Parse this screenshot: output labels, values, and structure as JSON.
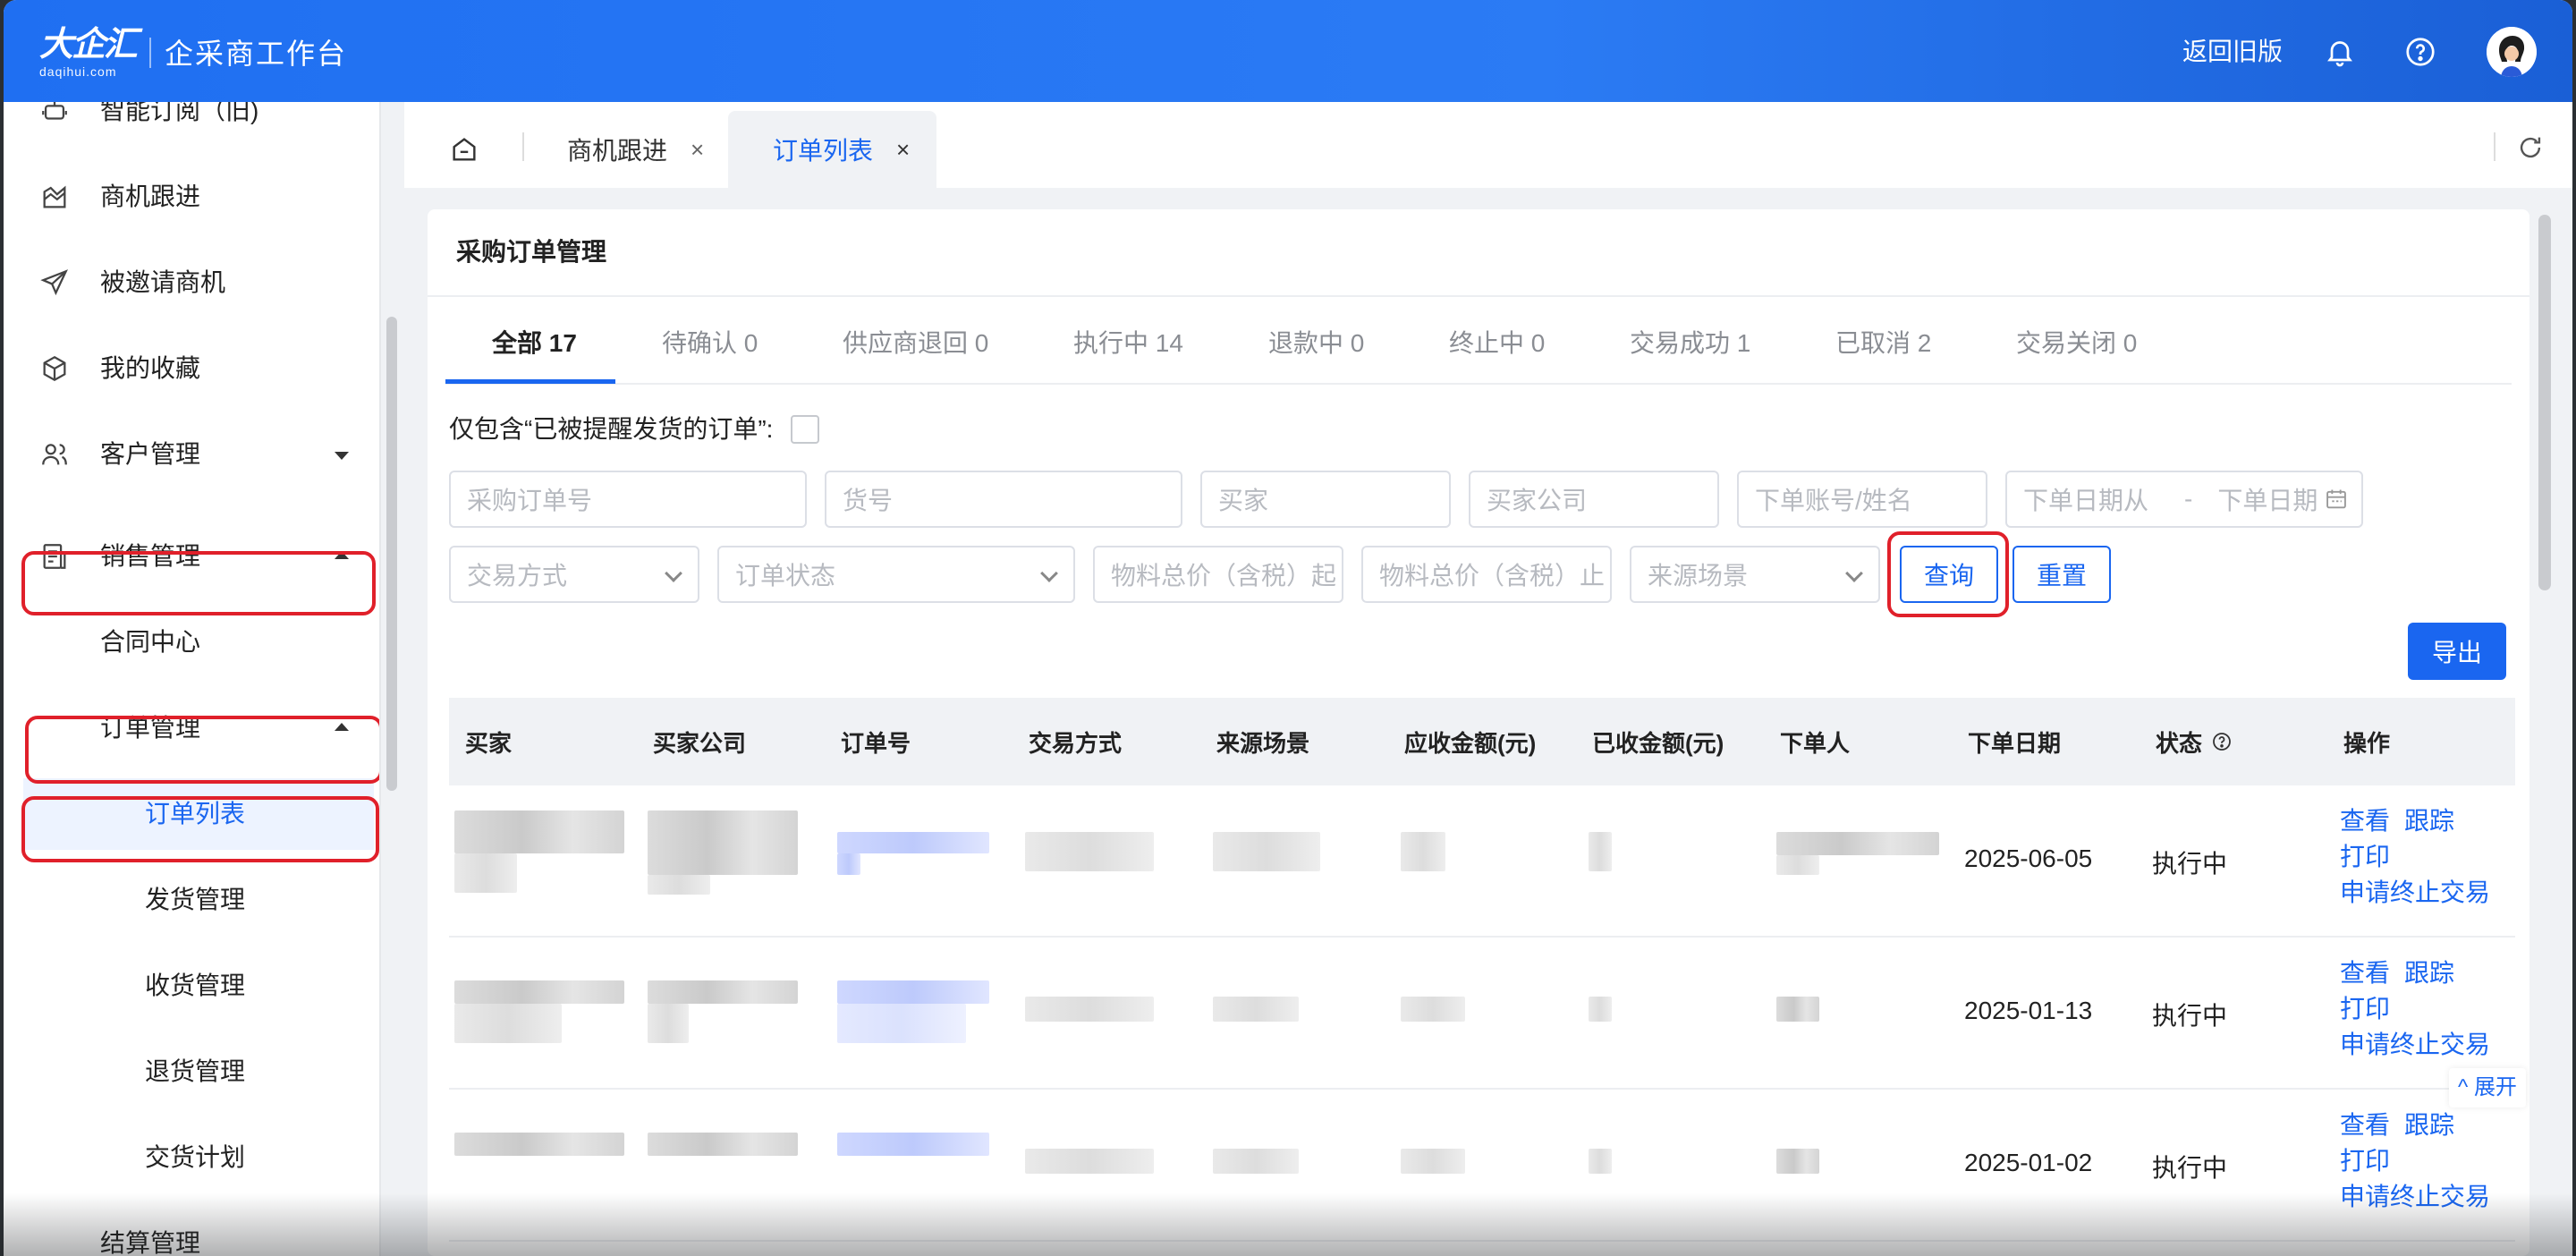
{
  "header": {
    "logo_main": "大企汇",
    "logo_sub": "daqihui.com",
    "app_title": "企采商工作台",
    "back_link": "返回旧版",
    "icons": [
      "bell-icon",
      "help-circle-icon"
    ]
  },
  "sidebar": {
    "items": [
      {
        "label": "智能订阅（旧)",
        "icon": "robot-icon"
      },
      {
        "label": "商机跟进",
        "icon": "trend-chart-icon"
      },
      {
        "label": "被邀请商机",
        "icon": "paper-plane-icon"
      },
      {
        "label": "我的收藏",
        "icon": "box-icon"
      },
      {
        "label": "客户管理",
        "icon": "users-icon"
      },
      {
        "label": "销售管理",
        "icon": "document-list-icon"
      },
      {
        "label": "合同中心"
      },
      {
        "label": "订单管理"
      },
      {
        "label": "订单列表"
      },
      {
        "label": "发货管理"
      },
      {
        "label": "收货管理"
      },
      {
        "label": "退货管理"
      },
      {
        "label": "交货计划"
      },
      {
        "label": "结算管理"
      }
    ]
  },
  "tabs": {
    "items": [
      {
        "label": "商机跟进",
        "close": "×"
      },
      {
        "label": "订单列表",
        "close": "×"
      }
    ]
  },
  "card": {
    "title": "采购订单管理",
    "status_tabs": [
      "全部 17",
      "待确认 0",
      "供应商退回 0",
      "执行中 14",
      "退款中 0",
      "终止中 0",
      "交易成功 1",
      "已取消 2",
      "交易关闭 0"
    ],
    "flag_label": "仅包含“已被提醒发货的订单”:"
  },
  "filters": {
    "order_no": "采购订单号",
    "item_no": "货号",
    "buyer": "买家",
    "buyer_company": "买家公司",
    "account": "下单账号/姓名",
    "date_from": "下单日期从",
    "date_sep": "-",
    "date_to": "下单日期",
    "trade_method": "交易方式",
    "order_status": "订单状态",
    "price_from": "物料总价（含税）起",
    "price_to": "物料总价（含税）止",
    "source": "来源场景",
    "query_btn": "查询",
    "reset_btn": "重置",
    "export_btn": "导出"
  },
  "table": {
    "columns": [
      "买家",
      "买家公司",
      "订单号",
      "交易方式",
      "来源场景",
      "应收金额(元)",
      "已收金额(元)",
      "下单人",
      "下单日期",
      "状态",
      "操作"
    ],
    "rows": [
      {
        "date": "2025-06-05",
        "status": "执行中",
        "ops": [
          "查看",
          "跟踪",
          "打印",
          "申请终止交易"
        ]
      },
      {
        "date": "2025-01-13",
        "status": "执行中",
        "ops": [
          "查看",
          "跟踪",
          "打印",
          "申请终止交易"
        ]
      },
      {
        "date": "2025-01-02",
        "status": "执行中",
        "ops": [
          "查看",
          "跟踪",
          "打印",
          "申请终止交易"
        ]
      }
    ],
    "expand_label": "展开"
  },
  "colors": {
    "brand": "#1f6ff2",
    "link": "#1a66f0",
    "highlight": "#e0202a"
  }
}
